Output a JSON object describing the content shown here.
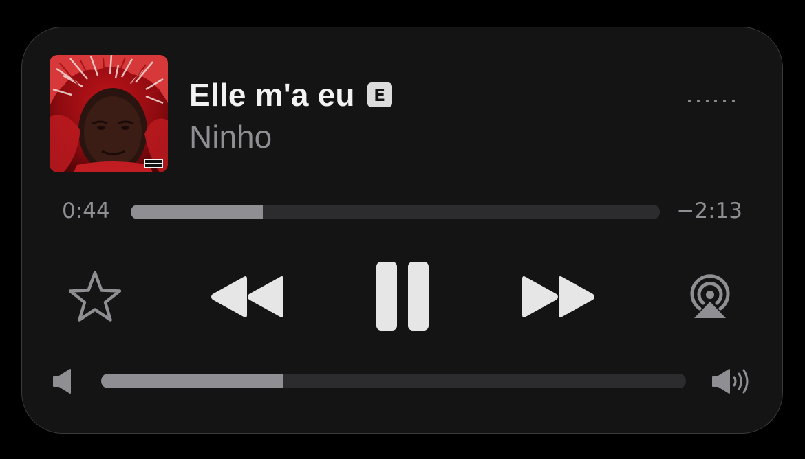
{
  "now_playing": {
    "title": "Elle m'a eu",
    "explicit_badge": "E",
    "artist": "Ninho",
    "artwork_icon": "album-artwork",
    "more_icon": "ellipsis-icon"
  },
  "playback": {
    "elapsed": "0:44",
    "remaining": "−2:13",
    "progress_fraction": 0.25,
    "state": "playing"
  },
  "controls": {
    "favorite_icon": "star-outline-icon",
    "previous_icon": "rewind-icon",
    "play_pause_icon": "pause-icon",
    "next_icon": "fast-forward-icon",
    "airplay_icon": "airplay-audio-icon"
  },
  "volume": {
    "level_fraction": 0.31,
    "min_icon": "speaker-low-icon",
    "max_icon": "speaker-high-icon"
  },
  "colors": {
    "background": "#000000",
    "panel": "#141414",
    "primary_text": "#f2f2f2",
    "secondary_text": "#8e8e93",
    "track": "#2c2c2e",
    "control": "#e6e6e6"
  }
}
